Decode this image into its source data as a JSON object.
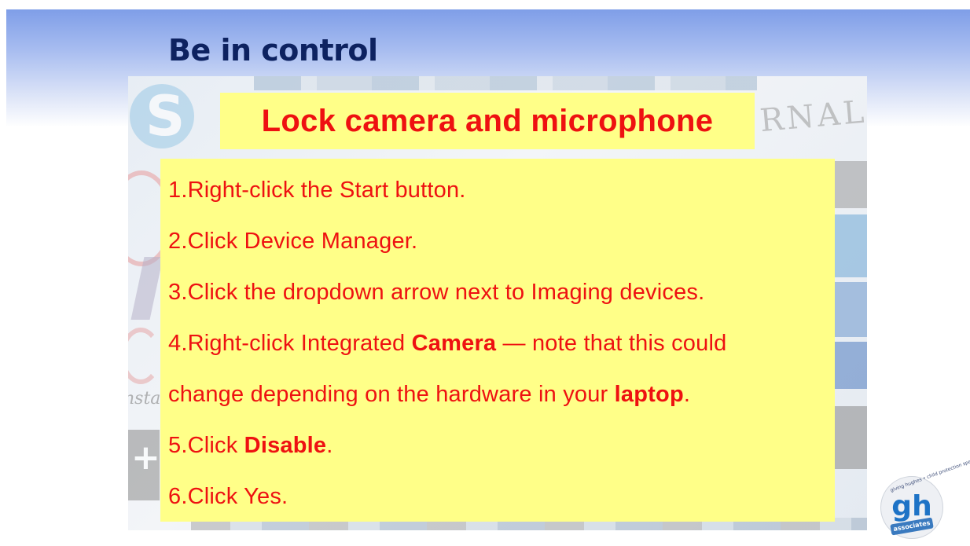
{
  "slide": {
    "title": "Be in control",
    "heading": "Lock camera and microphone",
    "steps": [
      {
        "a": "1.Right-click the Start button.",
        "b": "",
        "c": ""
      },
      {
        "a": "2.Click Device Manager.",
        "b": "",
        "c": ""
      },
      {
        "a": "3.Click the dropdown arrow next to Imaging devices.",
        "b": "",
        "c": ""
      },
      {
        "a": "4.Right-click Integrated ",
        "b": "Camera",
        "c": " — note that this could"
      },
      {
        "a": "change depending on the hardware in your ",
        "b": "laptop",
        "c": "."
      },
      {
        "a": "5.Click ",
        "b": "Disable",
        "c": "."
      },
      {
        "a": "6.Click Yes.",
        "b": "",
        "c": ""
      }
    ]
  },
  "background_collage": {
    "logo_text_journal": "URNAL",
    "logo_text_instagram": "nsta"
  },
  "badge": {
    "letters": "gh",
    "ribbon": "associates",
    "ring_text": "giving hughes • child protection specialists"
  },
  "colors": {
    "title": "#0d2260",
    "highlight_bg": "#ffff88",
    "step_text": "#ee1111",
    "badge_blue": "#1e73c6"
  }
}
